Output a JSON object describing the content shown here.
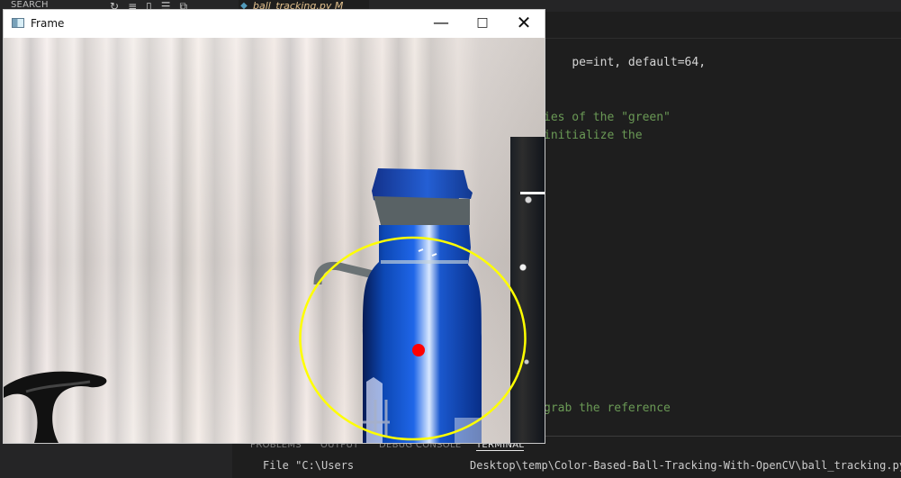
{
  "side_panel": {
    "title": "SEARCH",
    "actions": [
      "refresh-icon",
      "collapse-icon",
      "new-file-icon",
      "list-icon",
      "copy-icon"
    ]
  },
  "editor": {
    "tab_label": "ball_tracking.py M",
    "code_line_1": "pe=int, default=64,",
    "comment_line_1": "ies of the \"green\"",
    "comment_line_2": "initialize the",
    "comment_line_3": "grab the reference"
  },
  "panel": {
    "tabs": [
      "PROBLEMS",
      "OUTPUT",
      "DEBUG CONSOLE",
      "TERMINAL"
    ],
    "terminal_line_left": "File \"C:\\Users",
    "terminal_line_right": "Desktop\\temp\\Color-Based-Ball-Tracking-With-OpenCV\\ball_tracking.py\"",
    "terminal_second_line": "..."
  },
  "frame": {
    "title": "Frame",
    "minimize_symbol": "—",
    "maximize_symbol": "□",
    "close_symbol": "✕",
    "tracking_color": "#ffff00",
    "center_color": "#ff0000"
  }
}
